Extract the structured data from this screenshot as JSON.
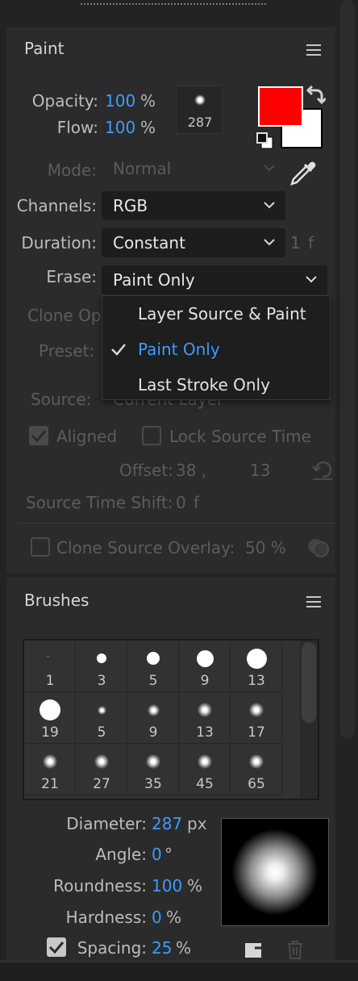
{
  "paint": {
    "title": "Paint",
    "opacity_label": "Opacity:",
    "opacity_value": "100",
    "opacity_unit": "%",
    "flow_label": "Flow:",
    "flow_value": "100",
    "flow_unit": "%",
    "brush_size": "287",
    "foreground_color": "#ff0000",
    "background_color": "#ffffff",
    "mode_label": "Mode:",
    "mode_value": "Normal",
    "channels_label": "Channels:",
    "channels_value": "RGB",
    "duration_label": "Duration:",
    "duration_value": "Constant",
    "duration_frames": "1",
    "duration_unit": "f",
    "erase_label": "Erase:",
    "erase_value": "Paint Only",
    "erase_options": [
      {
        "label": "Layer Source & Paint",
        "selected": false
      },
      {
        "label": "Paint Only",
        "selected": true
      },
      {
        "label": "Last Stroke Only",
        "selected": false
      }
    ],
    "clone_options_label": "Clone Op",
    "preset_label": "Preset:",
    "source_label": "Source:",
    "source_value": "Current Layer",
    "aligned_label": "Aligned",
    "aligned_checked": true,
    "lock_source_time_label": "Lock Source Time",
    "lock_source_time_checked": false,
    "offset_label": "Offset:",
    "offset_x": "38 ,",
    "offset_y": "13",
    "source_time_shift_label": "Source Time Shift:",
    "source_time_shift_value": "0",
    "source_time_shift_unit": "f",
    "clone_overlay_label": "Clone Source Overlay:",
    "clone_overlay_value": "50 %",
    "clone_overlay_checked": false
  },
  "brushes": {
    "title": "Brushes",
    "tips": [
      {
        "size": "1",
        "hard": true
      },
      {
        "size": "3",
        "hard": true
      },
      {
        "size": "5",
        "hard": true
      },
      {
        "size": "9",
        "hard": true
      },
      {
        "size": "13",
        "hard": true
      },
      {
        "size": "19",
        "hard": true
      },
      {
        "size": "5",
        "hard": false
      },
      {
        "size": "9",
        "hard": false
      },
      {
        "size": "13",
        "hard": false
      },
      {
        "size": "17",
        "hard": false
      },
      {
        "size": "21",
        "hard": false
      },
      {
        "size": "27",
        "hard": false
      },
      {
        "size": "35",
        "hard": false
      },
      {
        "size": "45",
        "hard": false
      },
      {
        "size": "65",
        "hard": false
      }
    ],
    "diameter_label": "Diameter:",
    "diameter_value": "287",
    "diameter_unit": "px",
    "angle_label": "Angle:",
    "angle_value": "0",
    "angle_unit": "°",
    "roundness_label": "Roundness:",
    "roundness_value": "100",
    "roundness_unit": "%",
    "hardness_label": "Hardness:",
    "hardness_value": "0",
    "hardness_unit": "%",
    "spacing_label": "Spacing:",
    "spacing_value": "25",
    "spacing_unit": "%",
    "spacing_checked": true
  }
}
